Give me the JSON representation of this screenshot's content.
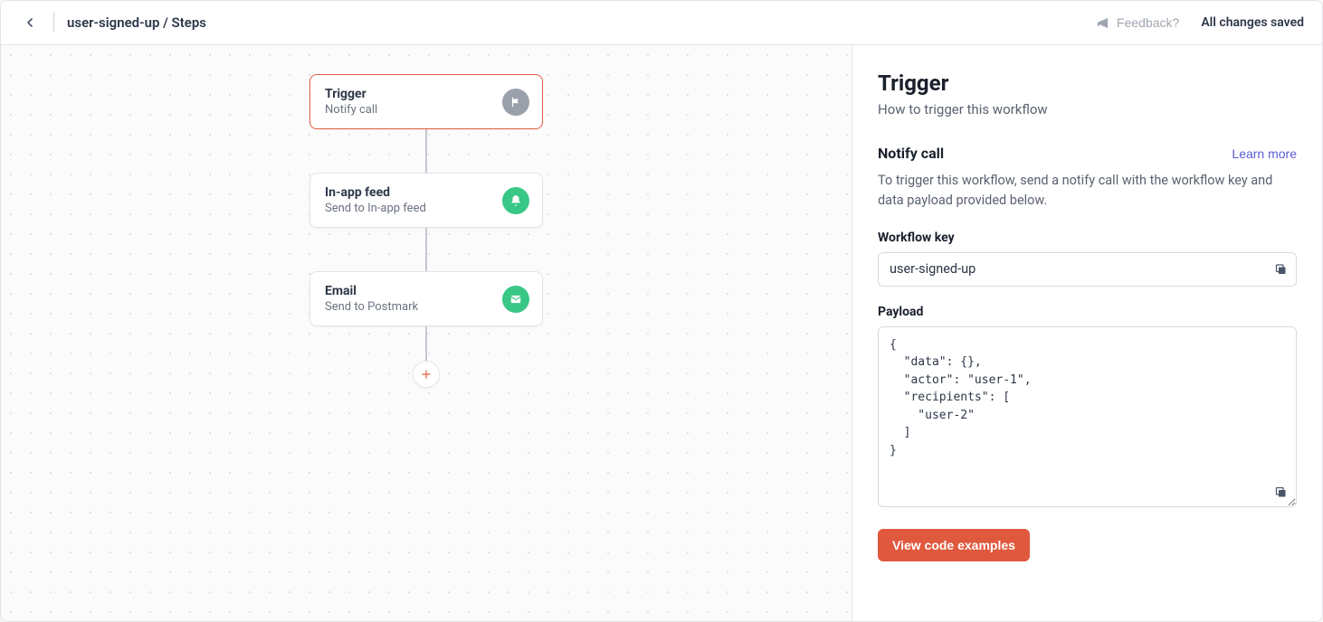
{
  "header": {
    "breadcrumb": "user-signed-up / Steps",
    "feedback_label": "Feedback?",
    "save_status": "All changes saved"
  },
  "canvas": {
    "nodes": [
      {
        "title": "Trigger",
        "sub": "Notify call",
        "icon": "flag",
        "color": "gray",
        "selected": true
      },
      {
        "title": "In-app feed",
        "sub": "Send to In-app feed",
        "icon": "bell",
        "color": "green",
        "selected": false
      },
      {
        "title": "Email",
        "sub": "Send to Postmark",
        "icon": "mail",
        "color": "green",
        "selected": false
      }
    ]
  },
  "panel": {
    "title": "Trigger",
    "subtitle": "How to trigger this workflow",
    "section_title": "Notify call",
    "learn_more": "Learn more",
    "section_desc": "To trigger this workflow, send a notify call with the workflow key and data payload provided below.",
    "workflow_key_label": "Workflow key",
    "workflow_key_value": "user-signed-up",
    "payload_label": "Payload",
    "payload_value": "{\n  \"data\": {},\n  \"actor\": \"user-1\",\n  \"recipients\": [\n    \"user-2\"\n  ]\n}",
    "code_examples_btn": "View code examples"
  }
}
